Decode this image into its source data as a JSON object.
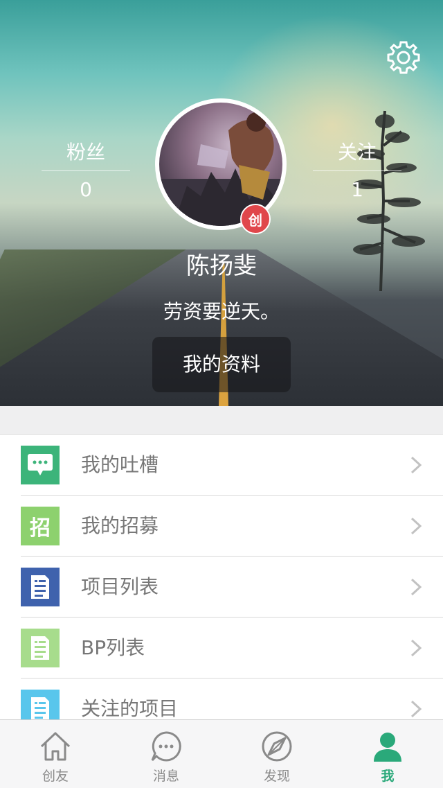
{
  "header": {
    "fans": {
      "label": "粉丝",
      "value": "0"
    },
    "follows": {
      "label": "关注",
      "value": "1"
    },
    "badge": "创",
    "name": "陈扬斐",
    "motto": "劳资要逆天。",
    "profile_button": "我的资料"
  },
  "menu": [
    {
      "label": "我的吐槽",
      "icon": "chat-bubble-icon",
      "color": "#3cb47a"
    },
    {
      "label": "我的招募",
      "icon": "recruit-icon",
      "glyph": "招",
      "color": "#8dd16e"
    },
    {
      "label": "项目列表",
      "icon": "document-icon",
      "color": "#3f62ad"
    },
    {
      "label": "BP列表",
      "icon": "document-icon",
      "color": "#a7dc8c"
    },
    {
      "label": "关注的项目",
      "icon": "document-icon",
      "color": "#59c6ec"
    }
  ],
  "tabbar": [
    {
      "label": "创友",
      "icon": "home-icon"
    },
    {
      "label": "消息",
      "icon": "message-icon"
    },
    {
      "label": "发现",
      "icon": "compass-icon"
    },
    {
      "label": "我",
      "icon": "person-icon",
      "active": true
    }
  ],
  "colors": {
    "accent": "#2aa97a",
    "badge": "#e0474b"
  }
}
